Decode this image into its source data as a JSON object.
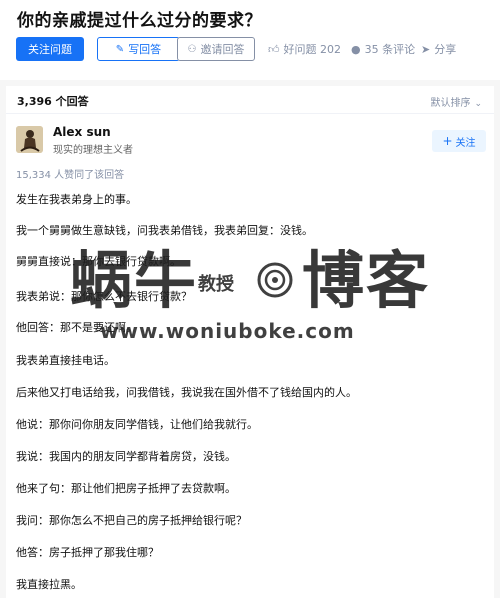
{
  "question": {
    "title": "你的亲戚提过什么过分的要求？",
    "follow_label": "关注问题",
    "write_label": "写回答",
    "invite_label": "邀请回答",
    "good_question_label": "好问题 202",
    "comments_label": "35 条评论",
    "share_label": "分享"
  },
  "answers_header": {
    "count_label": "3,396 个回答",
    "sort_label": "默认排序"
  },
  "answer": {
    "author_name": "Alex sun",
    "author_bio": "现实的理想主义者",
    "follow_label": "关注",
    "votes_label": "15,334 人赞同了该回答",
    "paragraphs": [
      "发生在我表弟身上的事。",
      "我一个舅舅做生意缺钱，问我表弟借钱，我表弟回复：没钱。",
      "舅舅直接说：那你去银行贷款啊。",
      "我表弟说：那你怎么不去银行贷款？",
      "他回答：那不是要还啊。",
      "我表弟直接挂电话。",
      "后来他又打电话给我，问我借钱，我说我在国外借不了钱给国内的人。",
      "他说：那你问你朋友同学借钱，让他们给我就行。",
      "我说：我国内的朋友同学都背着房贷，没钱。",
      "他来了句：那让他们把房子抵押了去贷款啊。",
      "我问：那你怎么不把自己的房子抵押给银行呢？",
      "他答：房子抵押了那我住哪？",
      "我直接拉黑。"
    ]
  },
  "watermark": {
    "main_text": "蜗牛博客",
    "sub_text": "教授",
    "url_text": "www.woniuboke.com"
  },
  "colors": {
    "accent": "#1772f6",
    "muted": "#8590a6"
  }
}
